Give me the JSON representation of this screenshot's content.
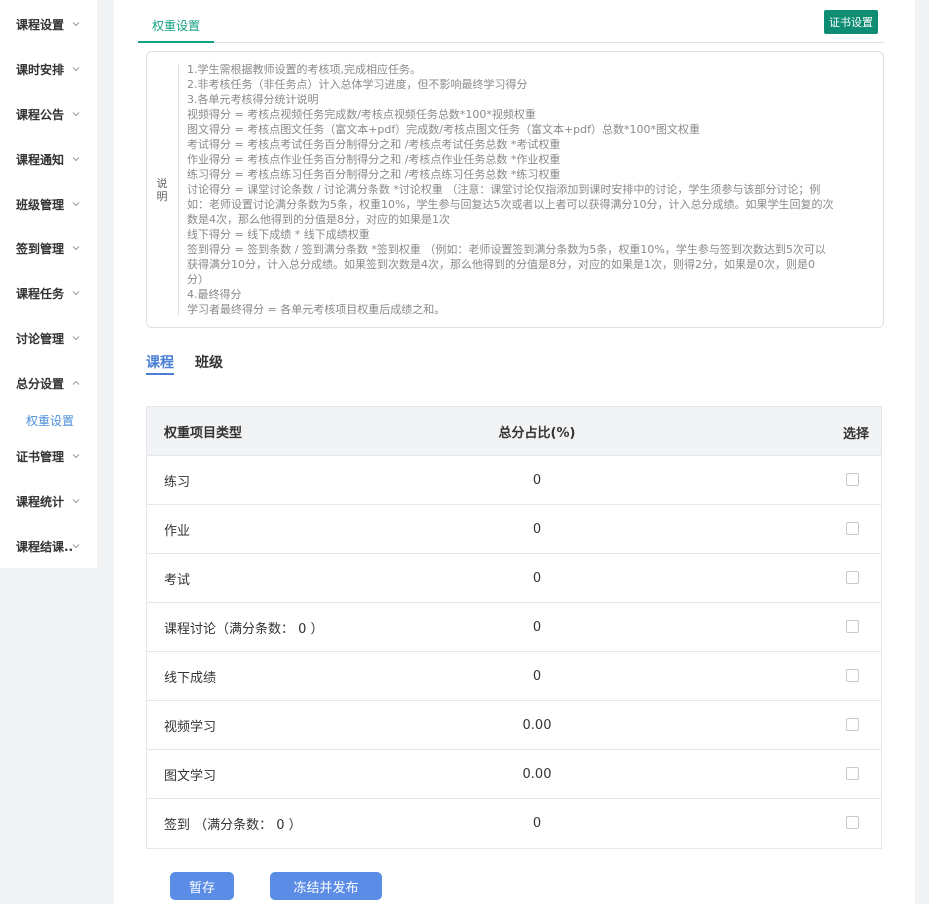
{
  "sidebar": {
    "items": [
      {
        "label": "课程设置"
      },
      {
        "label": "课时安排"
      },
      {
        "label": "课程公告"
      },
      {
        "label": "课程通知"
      },
      {
        "label": "班级管理"
      },
      {
        "label": "签到管理"
      },
      {
        "label": "课程任务"
      },
      {
        "label": "讨论管理"
      },
      {
        "label": "总分设置"
      },
      {
        "label": "证书管理"
      },
      {
        "label": "课程统计"
      },
      {
        "label": "课程结课..."
      }
    ],
    "sub_item": "权重设置"
  },
  "header": {
    "active_tab": "权重设置",
    "cert_button": "证书设置"
  },
  "description": {
    "label": "说明",
    "lines": [
      "1.学生需根据教师设置的考核项,完成相应任务。",
      "2.非考核任务（非任务点）计入总体学习进度，但不影响最终学习得分",
      "3.各单元考核得分统计说明",
      "视频得分 = 考核点视频任务完成数/考核点视频任务总数*100*视频权重",
      "图文得分 = 考核点图文任务（富文本+pdf）完成数/考核点图文任务（富文本+pdf）总数*100*图文权重",
      "考试得分 = 考核点考试任务百分制得分之和 /考核点考试任务总数 *考试权重",
      "作业得分 = 考核点作业任务百分制得分之和 /考核点作业任务总数 *作业权重",
      "练习得分 = 考核点练习任务百分制得分之和 /考核点练习任务总数 *练习权重",
      "讨论得分 = 课堂讨论条数 / 讨论满分条数 *讨论权重 （注意：课堂讨论仅指添加到课时安排中的讨论，学生须参与该部分讨论；例",
      "如：老师设置讨论满分条数为5条，权重10%，学生参与回复达5次或者以上者可以获得满分10分，计入总分成绩。如果学生回复的次",
      "数是4次，那么他得到的分值是8分，对应的如果是1次",
      "线下得分 = 线下成绩 * 线下成绩权重",
      "签到得分 = 签到条数 / 签到满分条数 *签到权重 （例如：老师设置签到满分条数为5条，权重10%，学生参与签到次数达到5次可以",
      "获得满分10分，计入总分成绩。如果签到次数是4次，那么他得到的分值是8分，对应的如果是1次，则得2分，如果是0次，则是0",
      "分）",
      "4.最终得分",
      "学习者最终得分 = 各单元考核项目权重后成绩之和。"
    ]
  },
  "content_tabs": {
    "course": "课程",
    "class": "班级"
  },
  "table": {
    "headers": {
      "type": "权重项目类型",
      "ratio": "总分占比(%)",
      "select": "选择"
    },
    "rows": [
      {
        "type": "练习",
        "ratio": "0"
      },
      {
        "type": "作业",
        "ratio": "0"
      },
      {
        "type": "考试",
        "ratio": "0"
      },
      {
        "type": "课程讨论（满分条数： 0 ）",
        "ratio": "0"
      },
      {
        "type": "线下成绩",
        "ratio": "0"
      },
      {
        "type": "视频学习",
        "ratio": "0.00"
      },
      {
        "type": "图文学习",
        "ratio": "0.00"
      },
      {
        "type": "签到 （满分条数： 0 ）",
        "ratio": "0"
      }
    ]
  },
  "footer": {
    "save_label": "暂存",
    "publish_label": "冻结并发布"
  }
}
